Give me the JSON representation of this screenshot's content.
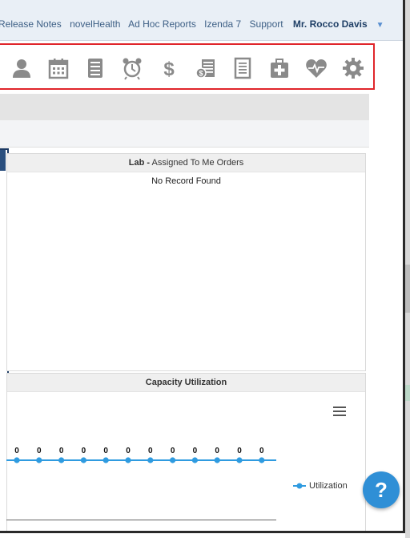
{
  "nav": {
    "links": [
      "Release Notes",
      "novelHealth",
      "Ad Hoc Reports",
      "Izenda 7",
      "Support"
    ],
    "user_name": "Mr. Rocco Davis",
    "user_caret": "▼"
  },
  "toolbar": {
    "icons": [
      "patient-icon",
      "calendar-icon",
      "records-icon",
      "alarm-clock-icon",
      "billing-dollar-icon",
      "payments-icon",
      "document-icon",
      "medical-kit-icon",
      "heart-health-icon",
      "settings-gear-icon"
    ],
    "icon_color": "#8a8a8a",
    "highlight_border": "#e0262b"
  },
  "lab_panel": {
    "title_bold": "Lab -",
    "title_rest": " Assigned To Me Orders",
    "empty_message": "No Record Found"
  },
  "capacity_panel": {
    "title": "Capacity Utilization",
    "menu_icon": "hamburger-menu-icon"
  },
  "help": {
    "label": "?",
    "color": "#2f8fd6"
  },
  "chart_data": {
    "type": "line",
    "series": [
      {
        "name": "Utilization",
        "values": [
          0,
          0,
          0,
          0,
          0,
          0,
          0,
          0,
          0,
          0,
          0,
          0
        ],
        "color": "#2f9be0"
      }
    ],
    "data_labels": [
      "0",
      "0",
      "0",
      "0",
      "0",
      "0",
      "0",
      "0",
      "0",
      "0",
      "0",
      "0"
    ],
    "title": "Capacity Utilization",
    "legend": "right",
    "grid": false
  }
}
